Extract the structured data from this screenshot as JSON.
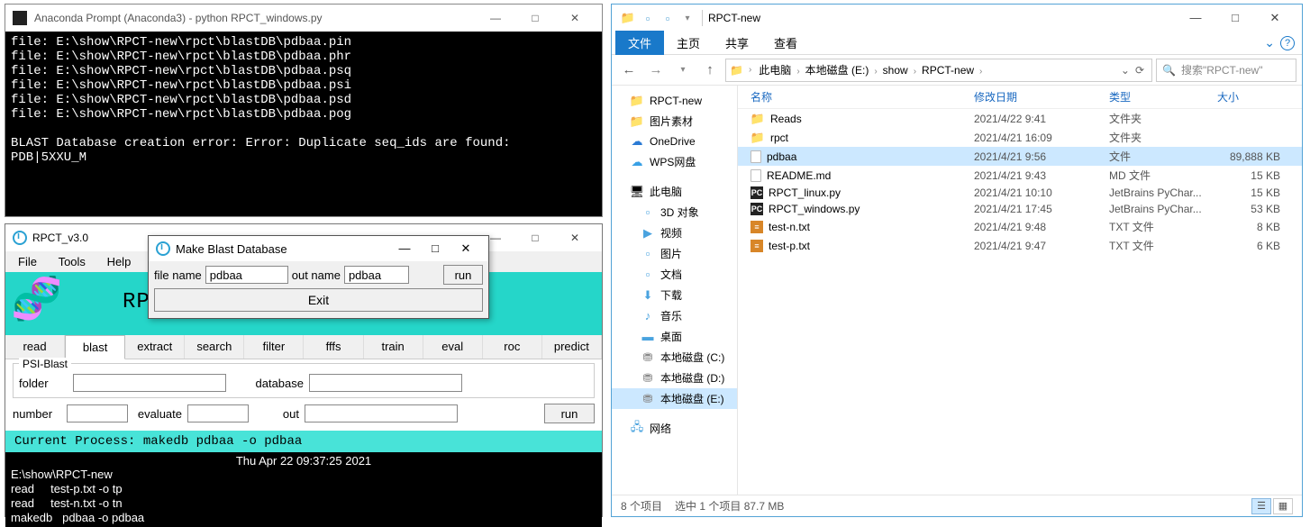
{
  "console": {
    "title": "Anaconda Prompt (Anaconda3) - python  RPCT_windows.py",
    "lines": "file: E:\\show\\RPCT-new\\rpct\\blastDB\\pdbaa.pin\nfile: E:\\show\\RPCT-new\\rpct\\blastDB\\pdbaa.phr\nfile: E:\\show\\RPCT-new\\rpct\\blastDB\\pdbaa.psq\nfile: E:\\show\\RPCT-new\\rpct\\blastDB\\pdbaa.psi\nfile: E:\\show\\RPCT-new\\rpct\\blastDB\\pdbaa.psd\nfile: E:\\show\\RPCT-new\\rpct\\blastDB\\pdbaa.pog\n\nBLAST Database creation error: Error: Duplicate seq_ids are found: \nPDB|5XXU_M",
    "btn_min": "—",
    "btn_max": "□",
    "btn_close": "✕"
  },
  "rpct": {
    "title": "RPCT_v3.0",
    "menu": {
      "file": "File",
      "tools": "Tools",
      "help": "Help"
    },
    "banner": "RPCT                         s Tool",
    "tabs": [
      "read",
      "blast",
      "extract",
      "search",
      "filter",
      "fffs",
      "train",
      "eval",
      "roc",
      "predict"
    ],
    "active_tab": 1,
    "form": {
      "legend": "PSI-Blast",
      "folder_label": "folder",
      "folder_val": "",
      "database_label": "database",
      "database_val": "",
      "number_label": "number",
      "number_val": "",
      "evaluate_label": "evaluate",
      "evaluate_val": "",
      "out_label": "out",
      "out_val": "",
      "run": "run"
    },
    "process_bar": " Current Process:  makedb  pdbaa -o pdbaa",
    "log_date": "Thu Apr 22 09:37:25 2021",
    "log": "E:\\show\\RPCT-new\nread     test-p.txt -o tp\nread     test-n.txt -o tn\nmakedb   pdbaa -o pdbaa",
    "btn_min": "—",
    "btn_max": "□",
    "btn_close": "✕"
  },
  "modal": {
    "title": "Make Blast Database",
    "file_label": "file name",
    "file_val": "pdbaa",
    "out_label": "out name",
    "out_val": "pdbaa",
    "run": "run",
    "exit": "Exit",
    "btn_min": "—",
    "btn_max": "□",
    "btn_close": "✕"
  },
  "explorer": {
    "title": "RPCT-new",
    "ribbon": {
      "file": "文件",
      "home": "主页",
      "share": "共享",
      "view": "查看"
    },
    "breadcrumb": [
      "此电脑",
      "本地磁盘 (E:)",
      "show",
      "RPCT-new"
    ],
    "search_ph": "搜索\"RPCT-new\"",
    "cols": {
      "name": "名称",
      "date": "修改日期",
      "type": "类型",
      "size": "大小"
    },
    "tree": [
      {
        "icon": "📁",
        "label": "RPCT-new",
        "cls": "folder-ico"
      },
      {
        "icon": "📁",
        "label": "图片素材",
        "cls": "folder-ico"
      },
      {
        "icon": "☁",
        "label": "OneDrive",
        "cls": "",
        "color": "#2a7ad4"
      },
      {
        "icon": "☁",
        "label": "WPS网盘",
        "cls": "",
        "color": "#38a0e5"
      },
      {
        "spacer": true
      },
      {
        "icon": "🖥",
        "label": "此电脑",
        "cls": ""
      },
      {
        "icon": "▫",
        "label": "3D 对象",
        "cls": "",
        "indent": true,
        "color": "#4aa3df"
      },
      {
        "icon": "▶",
        "label": "视频",
        "cls": "",
        "indent": true,
        "color": "#4aa3df"
      },
      {
        "icon": "▫",
        "label": "图片",
        "cls": "",
        "indent": true,
        "color": "#4aa3df"
      },
      {
        "icon": "▫",
        "label": "文档",
        "cls": "",
        "indent": true,
        "color": "#4aa3df"
      },
      {
        "icon": "⬇",
        "label": "下载",
        "cls": "",
        "indent": true,
        "color": "#4aa3df"
      },
      {
        "icon": "♪",
        "label": "音乐",
        "cls": "",
        "indent": true,
        "color": "#4aa3df"
      },
      {
        "icon": "▬",
        "label": "桌面",
        "cls": "",
        "indent": true,
        "color": "#4aa3df"
      },
      {
        "icon": "⛃",
        "label": "本地磁盘 (C:)",
        "cls": "",
        "indent": true,
        "color": "#888"
      },
      {
        "icon": "⛃",
        "label": "本地磁盘 (D:)",
        "cls": "",
        "indent": true,
        "color": "#888"
      },
      {
        "icon": "⛃",
        "label": "本地磁盘 (E:)",
        "cls": "",
        "indent": true,
        "sel": true,
        "color": "#888"
      },
      {
        "spacer": true
      },
      {
        "icon": "🖧",
        "label": "网络",
        "cls": "",
        "color": "#4aa3df"
      }
    ],
    "files": [
      {
        "icon": "folder",
        "name": "Reads",
        "date": "2021/4/22 9:41",
        "type": "文件夹",
        "size": ""
      },
      {
        "icon": "folder",
        "name": "rpct",
        "date": "2021/4/21 16:09",
        "type": "文件夹",
        "size": ""
      },
      {
        "icon": "blank",
        "name": "pdbaa",
        "date": "2021/4/21 9:56",
        "type": "文件",
        "size": "89,888 KB",
        "sel": true
      },
      {
        "icon": "blank",
        "name": "README.md",
        "date": "2021/4/21 9:43",
        "type": "MD 文件",
        "size": "15 KB"
      },
      {
        "icon": "py",
        "name": "RPCT_linux.py",
        "date": "2021/4/21 10:10",
        "type": "JetBrains PyChar...",
        "size": "15 KB"
      },
      {
        "icon": "py",
        "name": "RPCT_windows.py",
        "date": "2021/4/21 17:45",
        "type": "JetBrains PyChar...",
        "size": "53 KB"
      },
      {
        "icon": "txt",
        "name": "test-n.txt",
        "date": "2021/4/21 9:48",
        "type": "TXT 文件",
        "size": "8 KB"
      },
      {
        "icon": "txt",
        "name": "test-p.txt",
        "date": "2021/4/21 9:47",
        "type": "TXT 文件",
        "size": "6 KB"
      }
    ],
    "status": {
      "count": "8 个项目",
      "sel": "选中 1 个项目  87.7 MB"
    },
    "btn_min": "—",
    "btn_max": "□",
    "btn_close": "✕"
  }
}
